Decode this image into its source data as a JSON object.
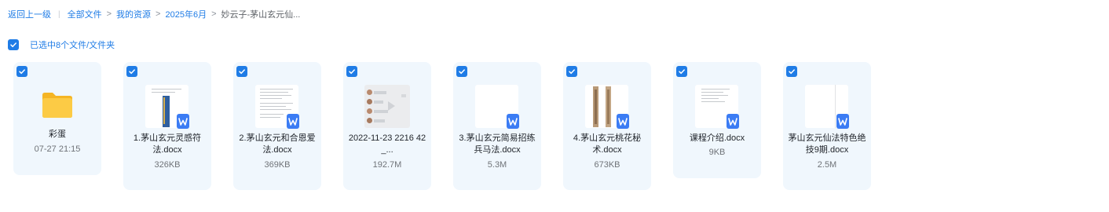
{
  "breadcrumb": {
    "back": "返回上一级",
    "crumbs": [
      "全部文件",
      "我的资源",
      "2025年6月"
    ],
    "current": "妙云子-茅山玄元仙...",
    "separator": ">",
    "divider": "|"
  },
  "selection": {
    "label": "已选中8个文件/文件夹",
    "checked": true
  },
  "files": [
    {
      "type": "folder",
      "name": "彩蛋",
      "meta": "07-27 21:15",
      "checked": true,
      "icon": "folder-icon"
    },
    {
      "type": "docx",
      "name": "1.茅山玄元灵感符法.docx",
      "meta": "326KB",
      "checked": true,
      "icon": "word-icon"
    },
    {
      "type": "docx",
      "name": "2.茅山玄元和合恩爱法.docx",
      "meta": "369KB",
      "checked": true,
      "icon": "word-icon"
    },
    {
      "type": "video",
      "name": "2022-11-23 2216 42_...",
      "meta": "192.7M",
      "checked": true,
      "icon": "video-icon"
    },
    {
      "type": "docx",
      "name": "3.茅山玄元简易招练兵马法.docx",
      "meta": "5.3M",
      "checked": true,
      "icon": "word-icon"
    },
    {
      "type": "docx",
      "name": "4.茅山玄元桃花秘术.docx",
      "meta": "673KB",
      "checked": true,
      "icon": "word-icon"
    },
    {
      "type": "docx",
      "name": "课程介绍.docx",
      "meta": "9KB",
      "checked": true,
      "icon": "word-icon"
    },
    {
      "type": "docx",
      "name": "茅山玄元仙法特色绝技9期.docx",
      "meta": "2.5M",
      "checked": true,
      "icon": "word-icon"
    }
  ],
  "colors": {
    "accent": "#1f7ce6",
    "card_bg": "#f0f7fd",
    "word_badge": "#3b7cf4",
    "folder": "#f8c433"
  }
}
